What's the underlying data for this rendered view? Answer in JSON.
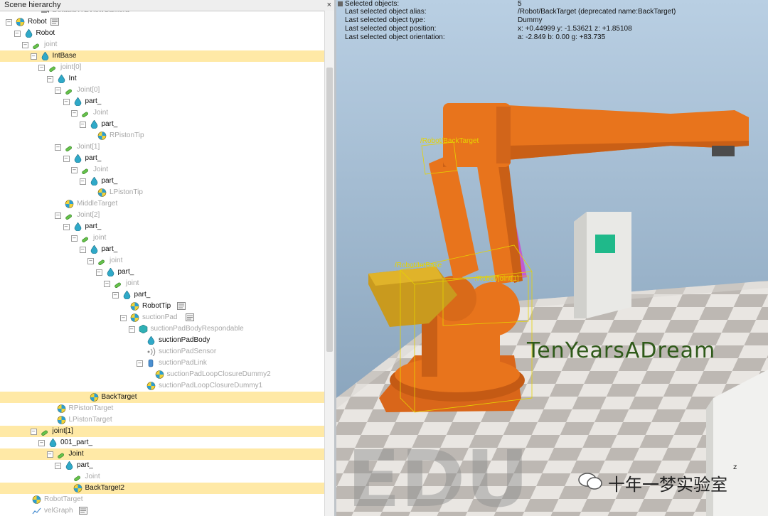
{
  "panel": {
    "title": "Scene hierarchy",
    "close": "×"
  },
  "tree": [
    {
      "label": "DefaultXYZViewCamera",
      "icon": "camera-icon",
      "dim": true,
      "depth": 3,
      "box": "",
      "sel": false,
      "aux": ""
    },
    {
      "label": "Robot",
      "icon": "model-icon",
      "dim": false,
      "depth": 0,
      "box": "–",
      "sel": false,
      "aux": "script-icon"
    },
    {
      "label": "Robot",
      "icon": "shape-icon",
      "dim": false,
      "depth": 1,
      "box": "–",
      "sel": false,
      "aux": ""
    },
    {
      "label": "joint",
      "icon": "joint-icon",
      "dim": true,
      "depth": 2,
      "box": "–",
      "sel": false,
      "aux": ""
    },
    {
      "label": "IntBase",
      "icon": "shape-icon",
      "dim": false,
      "depth": 3,
      "box": "–",
      "sel": true,
      "aux": ""
    },
    {
      "label": "joint[0]",
      "icon": "joint-icon",
      "dim": true,
      "depth": 4,
      "box": "–",
      "sel": false,
      "aux": ""
    },
    {
      "label": "Int",
      "icon": "shape-icon",
      "dim": false,
      "depth": 5,
      "box": "–",
      "sel": false,
      "aux": ""
    },
    {
      "label": "Joint[0]",
      "icon": "joint-icon",
      "dim": true,
      "depth": 6,
      "box": "–",
      "sel": false,
      "aux": ""
    },
    {
      "label": "part_",
      "icon": "shape-icon",
      "dim": false,
      "depth": 7,
      "box": "–",
      "sel": false,
      "aux": ""
    },
    {
      "label": "Joint",
      "icon": "joint-icon",
      "dim": true,
      "depth": 8,
      "box": "–",
      "sel": false,
      "aux": ""
    },
    {
      "label": "part_",
      "icon": "shape-icon",
      "dim": false,
      "depth": 9,
      "box": "–",
      "sel": false,
      "aux": ""
    },
    {
      "label": "RPistonTip",
      "icon": "dummy-icon",
      "dim": true,
      "depth": 10,
      "box": "",
      "sel": false,
      "aux": ""
    },
    {
      "label": "Joint[1]",
      "icon": "joint-icon",
      "dim": true,
      "depth": 6,
      "box": "–",
      "sel": false,
      "aux": ""
    },
    {
      "label": "part_",
      "icon": "shape-icon",
      "dim": false,
      "depth": 7,
      "box": "–",
      "sel": false,
      "aux": ""
    },
    {
      "label": "Joint",
      "icon": "joint-icon",
      "dim": true,
      "depth": 8,
      "box": "–",
      "sel": false,
      "aux": ""
    },
    {
      "label": "part_",
      "icon": "shape-icon",
      "dim": false,
      "depth": 9,
      "box": "–",
      "sel": false,
      "aux": ""
    },
    {
      "label": "LPistonTip",
      "icon": "dummy-icon",
      "dim": true,
      "depth": 10,
      "box": "",
      "sel": false,
      "aux": ""
    },
    {
      "label": "MiddleTarget",
      "icon": "dummy-icon",
      "dim": true,
      "depth": 6,
      "box": "",
      "sel": false,
      "aux": ""
    },
    {
      "label": "Joint[2]",
      "icon": "joint-icon",
      "dim": true,
      "depth": 6,
      "box": "–",
      "sel": false,
      "aux": ""
    },
    {
      "label": "part_",
      "icon": "shape-icon",
      "dim": false,
      "depth": 7,
      "box": "–",
      "sel": false,
      "aux": ""
    },
    {
      "label": "joint",
      "icon": "joint-icon",
      "dim": true,
      "depth": 8,
      "box": "–",
      "sel": false,
      "aux": ""
    },
    {
      "label": "part_",
      "icon": "shape-icon",
      "dim": false,
      "depth": 9,
      "box": "–",
      "sel": false,
      "aux": ""
    },
    {
      "label": "joint",
      "icon": "joint-icon",
      "dim": true,
      "depth": 10,
      "box": "–",
      "sel": false,
      "aux": ""
    },
    {
      "label": "part_",
      "icon": "shape-icon",
      "dim": false,
      "depth": 11,
      "box": "–",
      "sel": false,
      "aux": ""
    },
    {
      "label": "joint",
      "icon": "joint-icon",
      "dim": true,
      "depth": 12,
      "box": "–",
      "sel": false,
      "aux": ""
    },
    {
      "label": "part_",
      "icon": "shape-icon",
      "dim": false,
      "depth": 13,
      "box": "–",
      "sel": false,
      "aux": ""
    },
    {
      "label": "RobotTip",
      "icon": "dummy-icon",
      "dim": false,
      "depth": 14,
      "box": "",
      "sel": false,
      "aux": "script-icon"
    },
    {
      "label": "suctionPad",
      "icon": "model-icon",
      "dim": true,
      "depth": 14,
      "box": "–",
      "sel": false,
      "aux": "script-icon"
    },
    {
      "label": "suctionPadBodyRespondable",
      "icon": "cube-icon",
      "dim": true,
      "depth": 15,
      "box": "–",
      "sel": false,
      "aux": ""
    },
    {
      "label": "suctionPadBody",
      "icon": "shape-icon",
      "dim": false,
      "depth": 16,
      "box": "",
      "sel": false,
      "aux": ""
    },
    {
      "label": "suctionPadSensor",
      "icon": "sensor-icon",
      "dim": true,
      "depth": 16,
      "box": "",
      "sel": false,
      "aux": ""
    },
    {
      "label": "suctionPadLink",
      "icon": "link-icon",
      "dim": true,
      "depth": 16,
      "box": "–",
      "sel": false,
      "aux": ""
    },
    {
      "label": "suctionPadLoopClosureDummy2",
      "icon": "dummy-icon",
      "dim": true,
      "depth": 17,
      "box": "",
      "sel": false,
      "aux": ""
    },
    {
      "label": "suctionPadLoopClosureDummy1",
      "icon": "dummy-icon",
      "dim": true,
      "depth": 16,
      "box": "",
      "sel": false,
      "aux": ""
    },
    {
      "label": "BackTarget",
      "icon": "dummy-icon",
      "dim": false,
      "depth": 9,
      "box": "",
      "sel": true,
      "aux": ""
    },
    {
      "label": "RPistonTarget",
      "icon": "dummy-icon",
      "dim": true,
      "depth": 5,
      "box": "",
      "sel": false,
      "aux": ""
    },
    {
      "label": "LPistonTarget",
      "icon": "dummy-icon",
      "dim": true,
      "depth": 5,
      "box": "",
      "sel": false,
      "aux": ""
    },
    {
      "label": "joint[1]",
      "icon": "joint-icon",
      "dim": false,
      "depth": 3,
      "box": "–",
      "sel": true,
      "aux": ""
    },
    {
      "label": "001_part_",
      "icon": "shape-icon",
      "dim": false,
      "depth": 4,
      "box": "–",
      "sel": false,
      "aux": ""
    },
    {
      "label": "Joint",
      "icon": "joint-icon",
      "dim": false,
      "depth": 5,
      "box": "–",
      "sel": true,
      "aux": ""
    },
    {
      "label": "part_",
      "icon": "shape-icon",
      "dim": false,
      "depth": 6,
      "box": "–",
      "sel": false,
      "aux": ""
    },
    {
      "label": "Joint",
      "icon": "joint-icon",
      "dim": true,
      "depth": 7,
      "box": "",
      "sel": false,
      "aux": ""
    },
    {
      "label": "BackTarget2",
      "icon": "dummy-icon",
      "dim": false,
      "depth": 7,
      "box": "",
      "sel": true,
      "aux": ""
    },
    {
      "label": "RobotTarget",
      "icon": "dummy-icon",
      "dim": true,
      "depth": 2,
      "box": "",
      "sel": false,
      "aux": ""
    },
    {
      "label": "velGraph",
      "icon": "graph-icon",
      "dim": true,
      "depth": 2,
      "box": "",
      "sel": false,
      "aux": "script-icon"
    }
  ],
  "info": [
    {
      "key": "Selected objects:",
      "value": "5"
    },
    {
      "key": "Last selected object alias:",
      "value": "/Robot/BackTarget    (deprecated name:BackTarget)"
    },
    {
      "key": "Last selected object type:",
      "value": "Dummy"
    },
    {
      "key": "Last selected object position:",
      "value": "x: +0.44999    y: -1.53621    z: +1.85108"
    },
    {
      "key": "Last selected object orientation:",
      "value": "a: -2.849    b: 0.00    g: +83.735"
    }
  ],
  "scene": {
    "bbox_labels": [
      "/Robot/BackTarget",
      "/Robot/IntBase",
      "/Robot/joint[1]"
    ],
    "overlay_text": "TenYearsADream",
    "edu_watermark": "EDU",
    "brand_text": "十年一梦实验室",
    "brand_icon": "wechat-icon",
    "axis_label": "z"
  },
  "colors": {
    "robot": "#e8741c",
    "selection": "#ffe9a6",
    "bbox": "#e6d300",
    "overlay_text": "#2f5a1a"
  }
}
